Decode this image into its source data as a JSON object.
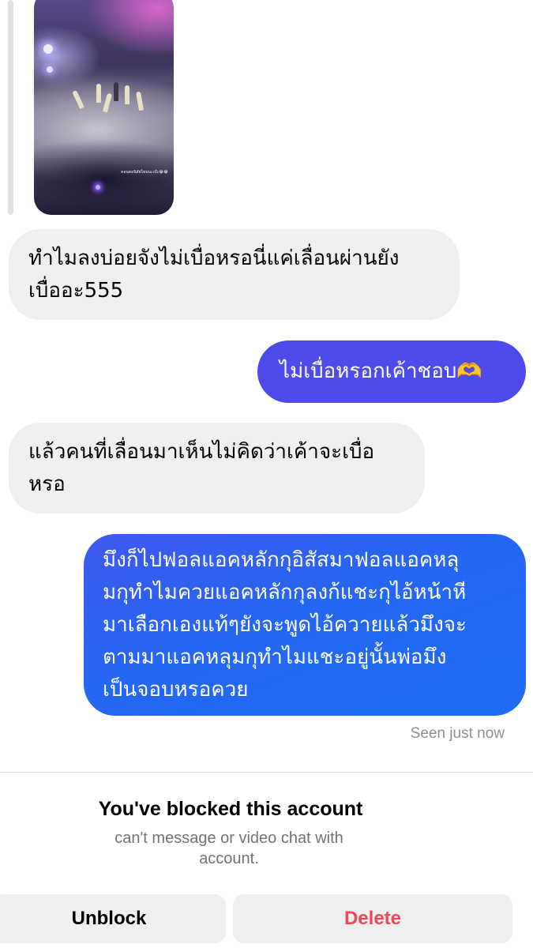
{
  "story_reply": {
    "caption": "คอนคอนิสัยไหมนะเบ๊ะ😂😂",
    "image_description_icon": "concert-stage-photo"
  },
  "messages": [
    {
      "sender": "them",
      "text": "ทำไมลงบ่อยจังไม่เบื่อหรอนี่แค่เลื่อนผ่านยัง\nเบื่ออะ555"
    },
    {
      "sender": "me",
      "text": "ไม่เบื่อหรอกเค้าชอบ🫶"
    },
    {
      "sender": "them",
      "text": "แล้วคนที่เลื่อนมาเห็นไม่คิดว่าเค้าจะเบื่อ\nหรอ"
    },
    {
      "sender": "me",
      "text": "มึงก็ไปฟอลแอคหลักกุอิสัสมาฟอลแอคหลุ\nมกุทำไมควยแอคหลักกุลงก้แชะกุไอ้หน้าหี\nมาเลือกเองแท้ๆยังจะพูดไอ้ควายแล้วมึงจะ\nตามมาแอคหลุมกุทำไมแชะอยู่นั้นพ่อมึง\nเป็นจอบหรอควย"
    }
  ],
  "seen_status": "Seen just now",
  "blocked_notice": {
    "title": "You've blocked this account",
    "message": "can't message or video chat with\naccount."
  },
  "actions": {
    "unblock_label": "Unblock",
    "delete_label": "Delete"
  },
  "colors": {
    "incoming_bubble": "#efefef",
    "outgoing_gradient_start": "#4f4bea",
    "outgoing_gradient_end": "#1f6df5",
    "delete_red": "#ed4956",
    "muted_text": "#8e8e8e"
  }
}
